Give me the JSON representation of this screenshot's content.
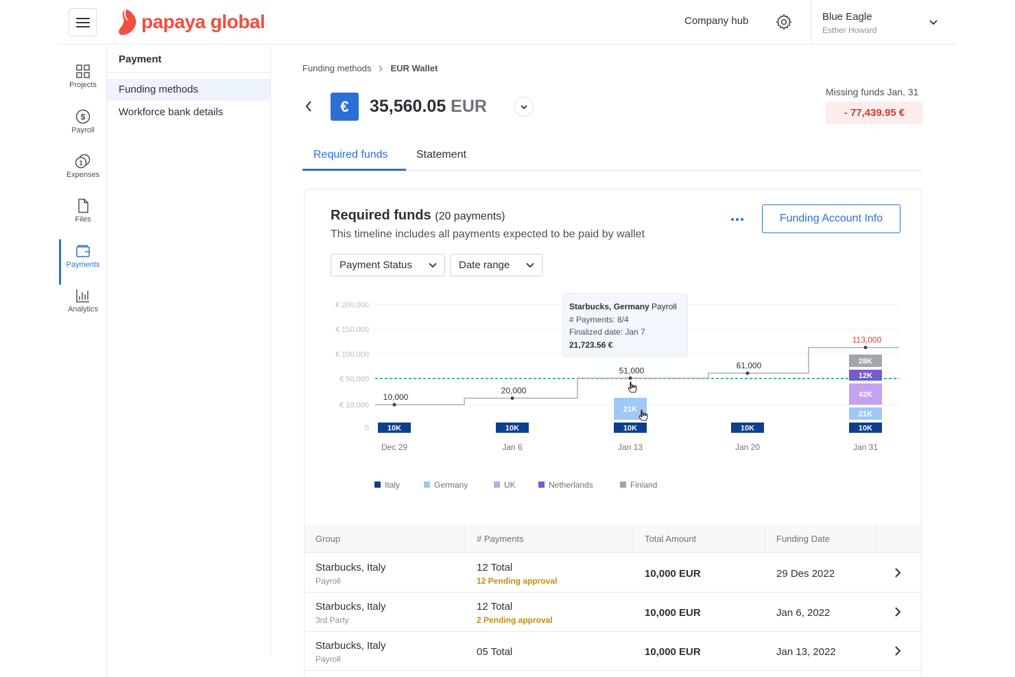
{
  "header": {
    "brand": "papaya global",
    "company_hub": "Company hub",
    "user_company": "Blue Eagle",
    "user_name": "Esther Howard"
  },
  "leftnav": {
    "items": [
      {
        "label": "Projects",
        "icon": "grid-icon"
      },
      {
        "label": "Payroll",
        "icon": "dollar-icon"
      },
      {
        "label": "Expenses",
        "icon": "coins-icon"
      },
      {
        "label": "Files",
        "icon": "file-icon"
      },
      {
        "label": "Payments",
        "icon": "wallet-icon",
        "active": true
      },
      {
        "label": "Analytics",
        "icon": "bar-chart-icon"
      }
    ]
  },
  "subnav": {
    "title": "Payment",
    "items": [
      {
        "label": "Funding methods",
        "active": true
      },
      {
        "label": "Workforce bank details"
      }
    ]
  },
  "breadcrumb": {
    "parent": "Funding methods",
    "current": "EUR Wallet"
  },
  "wallet": {
    "symbol": "€",
    "amount": "35,560.05",
    "currency": "EUR",
    "missing_label": "Missing funds Jan, 31",
    "missing_value": "- 77,439.95 €"
  },
  "tabs": [
    "Required funds",
    "Statement"
  ],
  "card": {
    "title": "Required funds",
    "count": "(20 payments)",
    "subtitle": "This timeline includes all payments expected to be paid by wallet",
    "button": "Funding Account Info",
    "filters": [
      "Payment Status",
      "Date range"
    ]
  },
  "colors": {
    "accent": "#2c6fd6",
    "italy": "#0d3f8f",
    "germany": "#9ec8f5",
    "uk": "#c3a2f0",
    "netherlands": "#7d57cf",
    "finland": "#a0a6ad",
    "threshold": "#1a9a78",
    "danger": "#d33a2e"
  },
  "chart_data": {
    "type": "bar",
    "categories": [
      "Dec 29",
      "Jan 6",
      "Jan 13",
      "Jan 20",
      "Jan 31"
    ],
    "y_tick_labels": [
      "0",
      "€ 10,000",
      "€ 50,000",
      "€ 100,000",
      "€ 150,000",
      "€ 200,000"
    ],
    "stacks": [
      [
        {
          "series": "Italy",
          "label": "10K"
        }
      ],
      [
        {
          "series": "Italy",
          "label": "10K"
        }
      ],
      [
        {
          "series": "Italy",
          "label": "10K"
        },
        {
          "series": "Germany",
          "label": "21K"
        }
      ],
      [
        {
          "series": "Italy",
          "label": "10K"
        }
      ],
      [
        {
          "series": "Italy",
          "label": "10K"
        },
        {
          "series": "Germany",
          "label": "21K"
        },
        {
          "series": "UK",
          "label": "42K"
        },
        {
          "series": "Netherlands",
          "label": "12K"
        },
        {
          "series": "Finland",
          "label": "28K"
        }
      ]
    ],
    "cumulative_line": {
      "values": [
        10000,
        20000,
        51000,
        61000,
        113000
      ],
      "labels": [
        "10,000",
        "20,000",
        "51,000",
        "61,000",
        "113,000"
      ]
    },
    "threshold_value": 35560,
    "legend": [
      "Italy",
      "Germany",
      "UK",
      "Netherlands",
      "Finland"
    ],
    "legend_position": "bottom",
    "tooltip": {
      "title_bold": "Starbucks, Germany",
      "title_rest": " Payroll",
      "line1": "# Payments: 8/4",
      "line2": "Finalized date: Jan 7",
      "line3": "21,723.56 €"
    }
  },
  "table": {
    "headers": [
      "Group",
      "# Payments",
      "Total Amount",
      "Funding Date"
    ],
    "rows": [
      {
        "group": "Starbucks, Italy",
        "type": "Payroll",
        "payments": "12 Total",
        "pending": "12 Pending approval",
        "amount": "10,000 EUR",
        "date": "29 Des 2022"
      },
      {
        "group": "Starbucks, Italy",
        "type": "3rd Party",
        "payments": "12 Total",
        "pending": "2 Pending approval",
        "amount": "10,000 EUR",
        "date": "Jan 6, 2022"
      },
      {
        "group": "Starbucks, Italy",
        "type": "Payroll",
        "payments": "05 Total",
        "pending": "",
        "amount": "10,000 EUR",
        "date": "Jan 13, 2022"
      }
    ]
  }
}
